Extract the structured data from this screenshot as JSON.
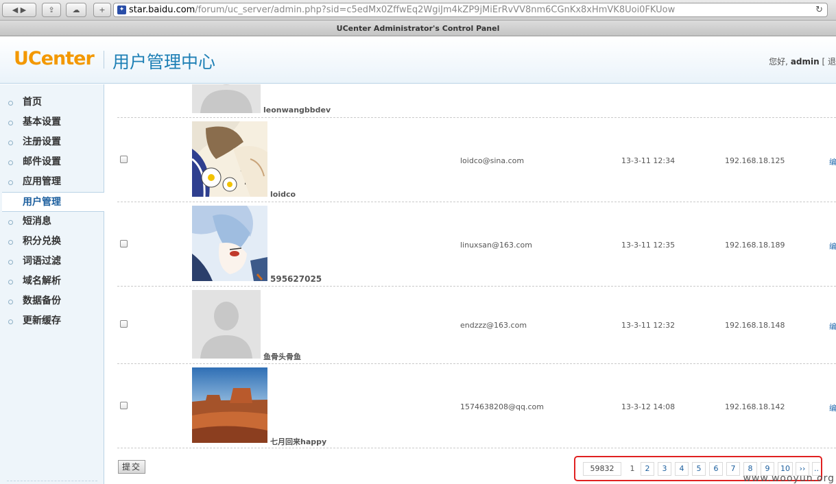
{
  "browser": {
    "url_host": "star.baidu.com",
    "url_path": "/forum/uc_server/admin.php?sid=c5edMx0ZffwEq2WgiJm4kZP9jMiErRvVV8nm6CGnKx8xHmVK8Uoi0FKUow",
    "window_title": "UCenter Administrator's Control Panel"
  },
  "header": {
    "logo": "UCenter",
    "title": "用户管理中心",
    "greeting": "您好,",
    "username": "admin",
    "logout_fragment": "[ 退"
  },
  "sidebar": {
    "items": [
      {
        "label": "首页"
      },
      {
        "label": "基本设置"
      },
      {
        "label": "注册设置"
      },
      {
        "label": "邮件设置"
      },
      {
        "label": "应用管理"
      },
      {
        "label": "用户管理"
      },
      {
        "label": "短消息"
      },
      {
        "label": "积分兑换"
      },
      {
        "label": "词语过滤"
      },
      {
        "label": "域名解析"
      },
      {
        "label": "数据备份"
      },
      {
        "label": "更新缓存"
      }
    ],
    "active_label": "用户管理"
  },
  "users": [
    {
      "name": "leonwangbbdev",
      "email": "",
      "date": "",
      "ip": "",
      "avatar": "default"
    },
    {
      "name": "loidco",
      "email": "loidco@sina.com",
      "date": "13-3-11 12:34",
      "ip": "192.168.18.125",
      "avatar": "illustration-girl"
    },
    {
      "name": "595627025",
      "email": "linuxsan@163.com",
      "date": "13-3-11 12:35",
      "ip": "192.168.18.189",
      "avatar": "illustration-anime"
    },
    {
      "name": "鱼骨头骨鱼",
      "email": "endzzz@163.com",
      "date": "13-3-11 12:32",
      "ip": "192.168.18.148",
      "avatar": "default"
    },
    {
      "name": "七月回来happy",
      "email": "1574638208@qq.com",
      "date": "13-3-12 14:08",
      "ip": "192.168.18.142",
      "avatar": "landscape-desert"
    }
  ],
  "edit_label": "编",
  "submit_label": "提交",
  "pagination": {
    "total": "59832",
    "pages": [
      "1",
      "2",
      "3",
      "4",
      "5",
      "6",
      "7",
      "8",
      "9",
      "10"
    ],
    "current": "1",
    "next": "››",
    "ellipsis": ".."
  },
  "watermark": "www.wooyun.org",
  "colors": {
    "accent": "#1d7fb5",
    "logo": "#f39800",
    "highlight": "#e02020"
  }
}
